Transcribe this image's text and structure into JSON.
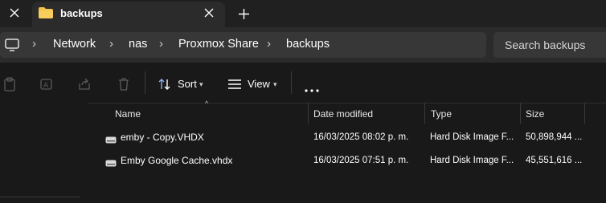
{
  "tab": {
    "title": "backups"
  },
  "address": {
    "crumbs": [
      "Network",
      "nas",
      "Proxmox Share",
      "backups"
    ]
  },
  "search": {
    "placeholder": "Search backups"
  },
  "toolbar": {
    "sort_label": "Sort",
    "view_label": "View"
  },
  "columns": {
    "name": "Name",
    "date": "Date modified",
    "type": "Type",
    "size": "Size"
  },
  "files": [
    {
      "name": "emby - Copy.VHDX",
      "date": "16/03/2025 08:02 p. m.",
      "type": "Hard Disk Image F...",
      "size": "50,898,944 ..."
    },
    {
      "name": "Emby Google Cache.vhdx",
      "date": "16/03/2025 07:51 p. m.",
      "type": "Hard Disk Image F...",
      "size": "45,551,616 ..."
    }
  ],
  "colors": {
    "folder": "#f4c34a",
    "background": "#191919",
    "tab_active": "#2b2b2b"
  }
}
